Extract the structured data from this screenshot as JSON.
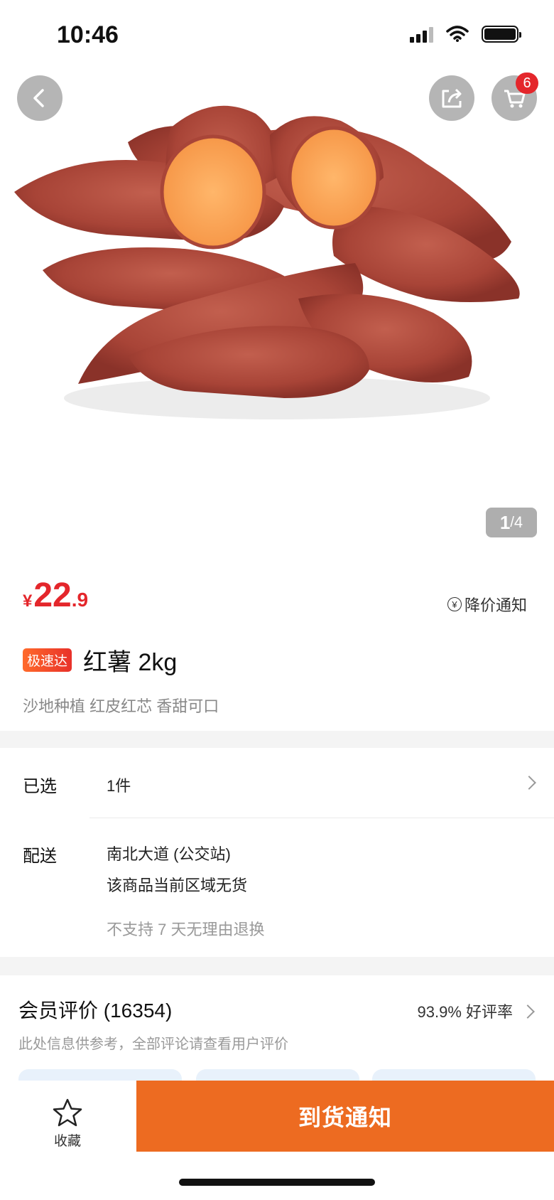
{
  "status_bar": {
    "time": "10:46"
  },
  "header": {
    "cart_count": "6"
  },
  "gallery": {
    "current": "1",
    "separator": "/",
    "total": "4"
  },
  "product": {
    "currency": "¥",
    "price_int": "22",
    "price_dec": ".9",
    "price_drop_notice": "降价通知",
    "express_tag": "极速达",
    "title": "红薯 2kg",
    "subtitle": "沙地种植 红皮红芯 香甜可口"
  },
  "options": {
    "selected_label": "已选",
    "selected_value": "1件",
    "delivery_label": "配送",
    "delivery_address": "南北大道 (公交站)",
    "delivery_status": "该商品当前区域无货",
    "return_policy": "不支持 7 天无理由退换"
  },
  "reviews": {
    "title": "会员评价 (16354)",
    "positive_rate": "93.9% 好评率",
    "note": "此处信息供参考，全部评论请查看用户评价"
  },
  "bottom_bar": {
    "favorite_label": "收藏",
    "notify_button": "到货通知"
  },
  "colors": {
    "price_red": "#e4262b",
    "action_orange": "#ed6b21",
    "badge_red": "#e4262b"
  },
  "icons": [
    "back-icon",
    "share-icon",
    "cart-icon",
    "price-drop-icon",
    "chevron-right-icon",
    "star-icon"
  ]
}
